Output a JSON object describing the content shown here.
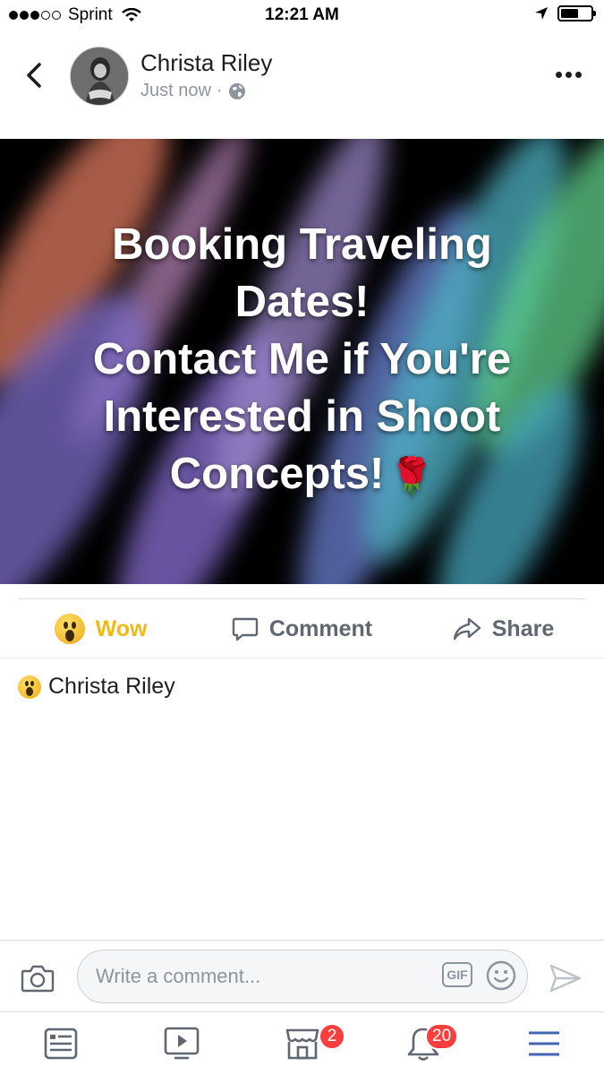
{
  "status_bar": {
    "carrier": "Sprint",
    "time": "12:21 AM",
    "battery_level": 0.6
  },
  "post": {
    "author": "Christa Riley",
    "timestamp": "Just now",
    "separator": "·",
    "privacy_icon": "globe-icon",
    "image_text_lines": [
      "Booking Traveling",
      "Dates!",
      "Contact Me if You're",
      "Interested in Shoot",
      "Concepts!"
    ],
    "image_emoji": "🌹"
  },
  "actions": {
    "wow_label": "Wow",
    "comment_label": "Comment",
    "share_label": "Share"
  },
  "reactions": {
    "reactor_name": "Christa Riley"
  },
  "composer": {
    "placeholder": "Write a comment...",
    "gif_label": "GIF"
  },
  "tabs": {
    "marketplace_badge": "2",
    "notifications_badge": "20"
  },
  "colors": {
    "wow_accent": "#f0ba15",
    "badge_red": "#fa3e3e",
    "active_tab_blue": "#4267b2",
    "icon_gray": "#606770"
  }
}
